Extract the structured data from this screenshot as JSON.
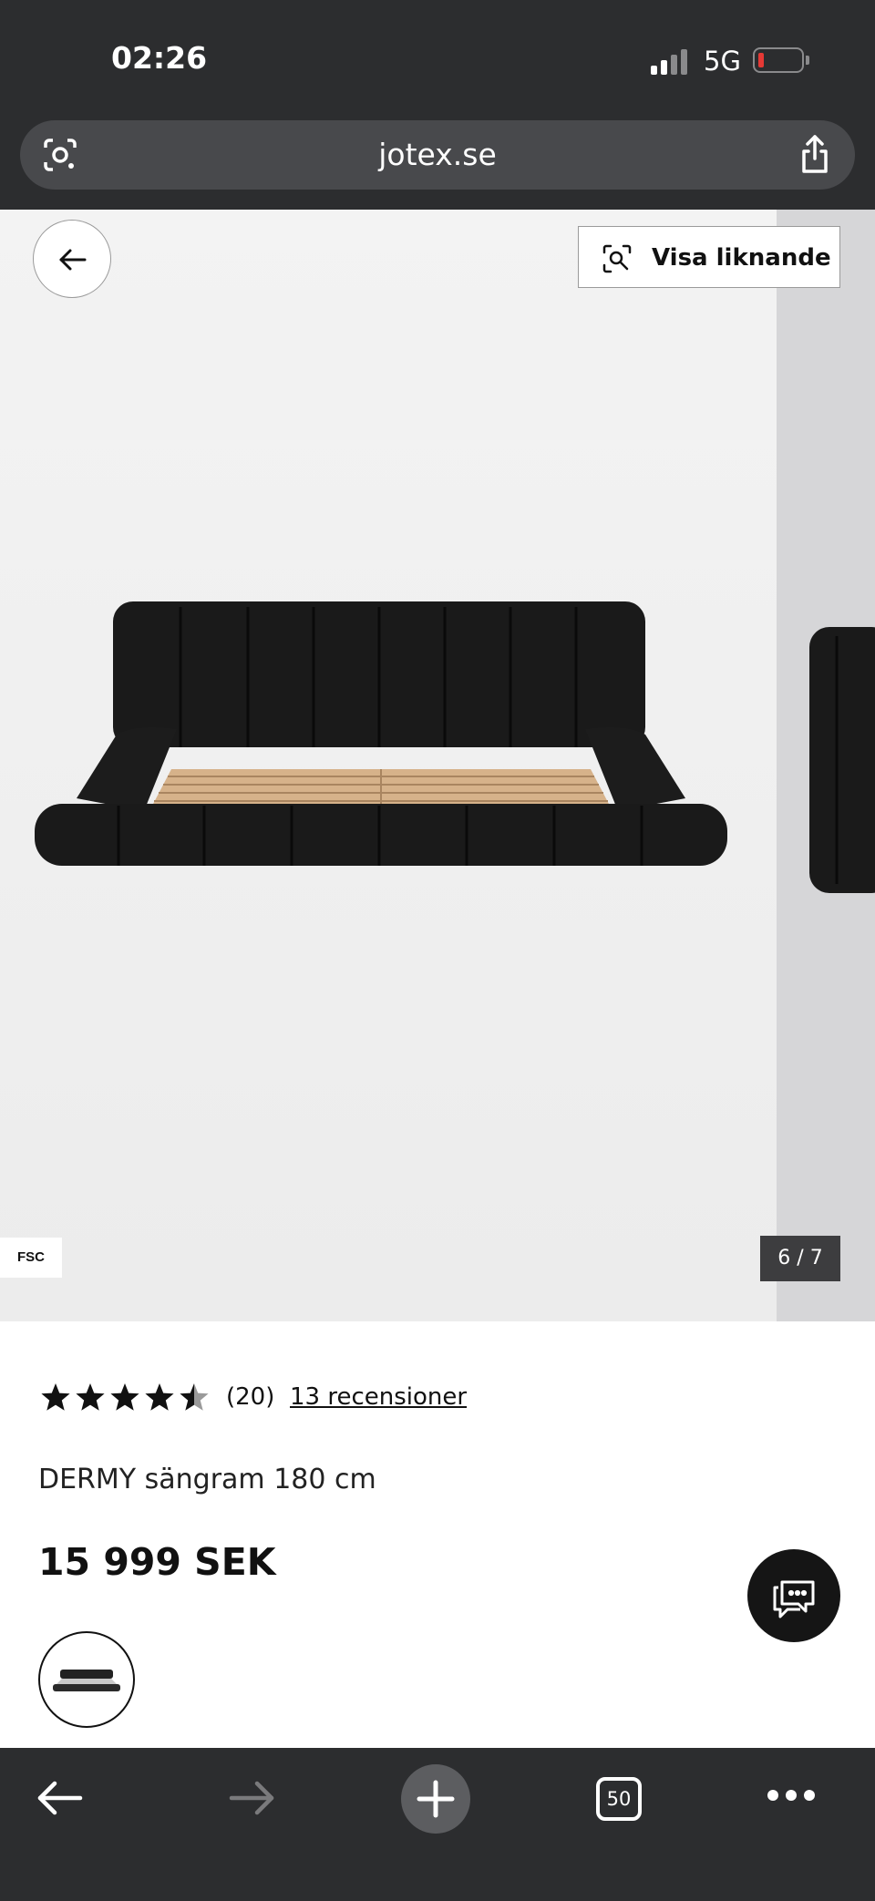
{
  "status_bar": {
    "time": "02:26",
    "network": "5G",
    "battery_color": "#e53935"
  },
  "browser": {
    "url": "jotex.se"
  },
  "gallery": {
    "similar_label": "Visa liknande",
    "badge": "FSC",
    "pager": "6 / 7"
  },
  "product": {
    "rating_value": 4.5,
    "rating_count": "(20)",
    "reviews_link": "13 recensioner",
    "name": "DERMY sängram 180 cm",
    "price": "15 999 SEK"
  },
  "toolbar": {
    "tab_count": "50"
  }
}
